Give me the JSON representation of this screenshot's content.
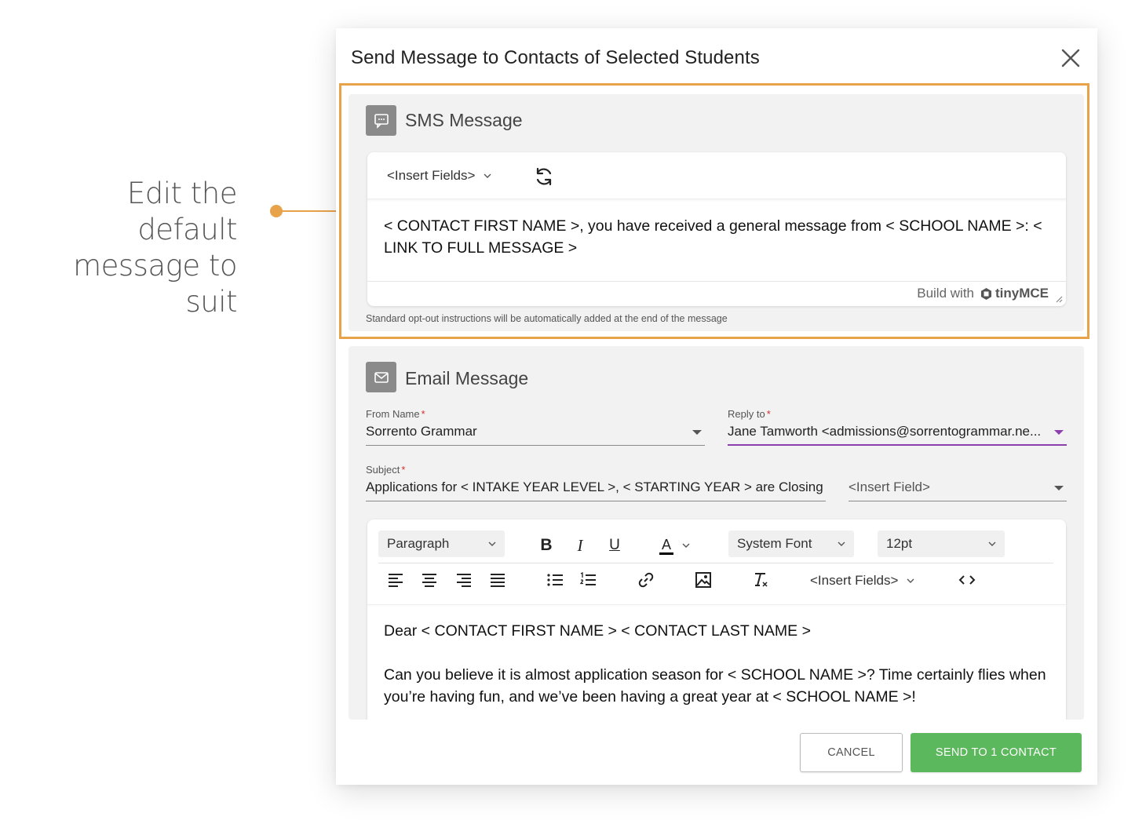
{
  "callout": {
    "line1": "Edit the default",
    "line2": "message to suit",
    "accent_color": "#e8a24a"
  },
  "dialog": {
    "title": "Send Message to Contacts of Selected Students"
  },
  "sms": {
    "title": "SMS Message",
    "icon": "chat-bubble-icon",
    "insert_fields_label": "<Insert Fields>",
    "body": "< CONTACT FIRST NAME >, you have received a general message from < SCHOOL NAME >: < LINK TO FULL MESSAGE >",
    "build_with": "Build with",
    "brand": "tinyMCE",
    "note": "Standard opt-out instructions will be automatically added at the end of the message"
  },
  "email": {
    "title": "Email Message",
    "icon": "envelope-icon",
    "from_name": {
      "label": "From Name",
      "value": "Sorrento Grammar"
    },
    "reply_to": {
      "label": "Reply to",
      "value": "Jane Tamworth <admissions@sorrentogrammar.ne..."
    },
    "subject": {
      "label": "Subject",
      "value": "Applications for < INTAKE YEAR LEVEL >, < STARTING YEAR > are Closing Sc"
    },
    "insert_field": {
      "value": "<Insert Field>"
    },
    "toolbar": {
      "block_format": "Paragraph",
      "font_family": "System Font",
      "font_size": "12pt",
      "bold": "B",
      "italic": "I",
      "underline": "U",
      "text_color": "A",
      "insert_fields_label": "<Insert Fields>"
    },
    "body": {
      "greeting": "Dear < CONTACT FIRST NAME > < CONTACT LAST NAME >",
      "paragraph1": "Can you believe it is almost application season for < SCHOOL NAME >? Time certainly flies when you’re having fun, and we’ve been having a great year at < SCHOOL NAME >!"
    }
  },
  "actions": {
    "cancel": "CANCEL",
    "send": "SEND TO 1 CONTACT",
    "send_color": "#5cb85c"
  },
  "colors": {
    "required": "#d32f2f",
    "active_underline": "#8e3fae"
  }
}
